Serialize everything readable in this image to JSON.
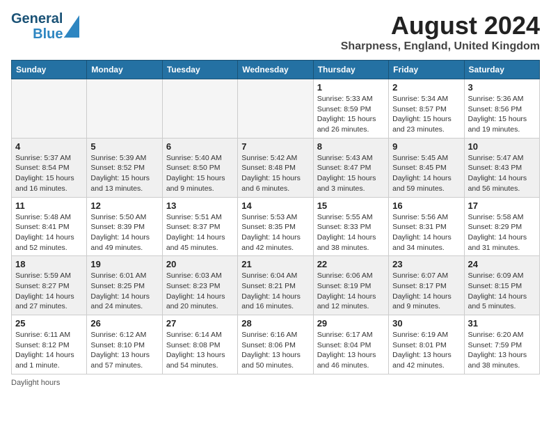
{
  "header": {
    "logo_general": "General",
    "logo_blue": "Blue",
    "main_title": "August 2024",
    "subtitle": "Sharpness, England, United Kingdom"
  },
  "columns": [
    "Sunday",
    "Monday",
    "Tuesday",
    "Wednesday",
    "Thursday",
    "Friday",
    "Saturday"
  ],
  "weeks": [
    [
      {
        "day": "",
        "info": "",
        "empty": true
      },
      {
        "day": "",
        "info": "",
        "empty": true
      },
      {
        "day": "",
        "info": "",
        "empty": true
      },
      {
        "day": "",
        "info": "",
        "empty": true
      },
      {
        "day": "1",
        "info": "Sunrise: 5:33 AM\nSunset: 8:59 PM\nDaylight: 15 hours\nand 26 minutes."
      },
      {
        "day": "2",
        "info": "Sunrise: 5:34 AM\nSunset: 8:57 PM\nDaylight: 15 hours\nand 23 minutes."
      },
      {
        "day": "3",
        "info": "Sunrise: 5:36 AM\nSunset: 8:56 PM\nDaylight: 15 hours\nand 19 minutes."
      }
    ],
    [
      {
        "day": "4",
        "info": "Sunrise: 5:37 AM\nSunset: 8:54 PM\nDaylight: 15 hours\nand 16 minutes."
      },
      {
        "day": "5",
        "info": "Sunrise: 5:39 AM\nSunset: 8:52 PM\nDaylight: 15 hours\nand 13 minutes."
      },
      {
        "day": "6",
        "info": "Sunrise: 5:40 AM\nSunset: 8:50 PM\nDaylight: 15 hours\nand 9 minutes."
      },
      {
        "day": "7",
        "info": "Sunrise: 5:42 AM\nSunset: 8:48 PM\nDaylight: 15 hours\nand 6 minutes."
      },
      {
        "day": "8",
        "info": "Sunrise: 5:43 AM\nSunset: 8:47 PM\nDaylight: 15 hours\nand 3 minutes."
      },
      {
        "day": "9",
        "info": "Sunrise: 5:45 AM\nSunset: 8:45 PM\nDaylight: 14 hours\nand 59 minutes."
      },
      {
        "day": "10",
        "info": "Sunrise: 5:47 AM\nSunset: 8:43 PM\nDaylight: 14 hours\nand 56 minutes."
      }
    ],
    [
      {
        "day": "11",
        "info": "Sunrise: 5:48 AM\nSunset: 8:41 PM\nDaylight: 14 hours\nand 52 minutes."
      },
      {
        "day": "12",
        "info": "Sunrise: 5:50 AM\nSunset: 8:39 PM\nDaylight: 14 hours\nand 49 minutes."
      },
      {
        "day": "13",
        "info": "Sunrise: 5:51 AM\nSunset: 8:37 PM\nDaylight: 14 hours\nand 45 minutes."
      },
      {
        "day": "14",
        "info": "Sunrise: 5:53 AM\nSunset: 8:35 PM\nDaylight: 14 hours\nand 42 minutes."
      },
      {
        "day": "15",
        "info": "Sunrise: 5:55 AM\nSunset: 8:33 PM\nDaylight: 14 hours\nand 38 minutes."
      },
      {
        "day": "16",
        "info": "Sunrise: 5:56 AM\nSunset: 8:31 PM\nDaylight: 14 hours\nand 34 minutes."
      },
      {
        "day": "17",
        "info": "Sunrise: 5:58 AM\nSunset: 8:29 PM\nDaylight: 14 hours\nand 31 minutes."
      }
    ],
    [
      {
        "day": "18",
        "info": "Sunrise: 5:59 AM\nSunset: 8:27 PM\nDaylight: 14 hours\nand 27 minutes."
      },
      {
        "day": "19",
        "info": "Sunrise: 6:01 AM\nSunset: 8:25 PM\nDaylight: 14 hours\nand 24 minutes."
      },
      {
        "day": "20",
        "info": "Sunrise: 6:03 AM\nSunset: 8:23 PM\nDaylight: 14 hours\nand 20 minutes."
      },
      {
        "day": "21",
        "info": "Sunrise: 6:04 AM\nSunset: 8:21 PM\nDaylight: 14 hours\nand 16 minutes."
      },
      {
        "day": "22",
        "info": "Sunrise: 6:06 AM\nSunset: 8:19 PM\nDaylight: 14 hours\nand 12 minutes."
      },
      {
        "day": "23",
        "info": "Sunrise: 6:07 AM\nSunset: 8:17 PM\nDaylight: 14 hours\nand 9 minutes."
      },
      {
        "day": "24",
        "info": "Sunrise: 6:09 AM\nSunset: 8:15 PM\nDaylight: 14 hours\nand 5 minutes."
      }
    ],
    [
      {
        "day": "25",
        "info": "Sunrise: 6:11 AM\nSunset: 8:12 PM\nDaylight: 14 hours\nand 1 minute."
      },
      {
        "day": "26",
        "info": "Sunrise: 6:12 AM\nSunset: 8:10 PM\nDaylight: 13 hours\nand 57 minutes."
      },
      {
        "day": "27",
        "info": "Sunrise: 6:14 AM\nSunset: 8:08 PM\nDaylight: 13 hours\nand 54 minutes."
      },
      {
        "day": "28",
        "info": "Sunrise: 6:16 AM\nSunset: 8:06 PM\nDaylight: 13 hours\nand 50 minutes."
      },
      {
        "day": "29",
        "info": "Sunrise: 6:17 AM\nSunset: 8:04 PM\nDaylight: 13 hours\nand 46 minutes."
      },
      {
        "day": "30",
        "info": "Sunrise: 6:19 AM\nSunset: 8:01 PM\nDaylight: 13 hours\nand 42 minutes."
      },
      {
        "day": "31",
        "info": "Sunrise: 6:20 AM\nSunset: 7:59 PM\nDaylight: 13 hours\nand 38 minutes."
      }
    ]
  ],
  "footer": {
    "daylight_label": "Daylight hours"
  }
}
